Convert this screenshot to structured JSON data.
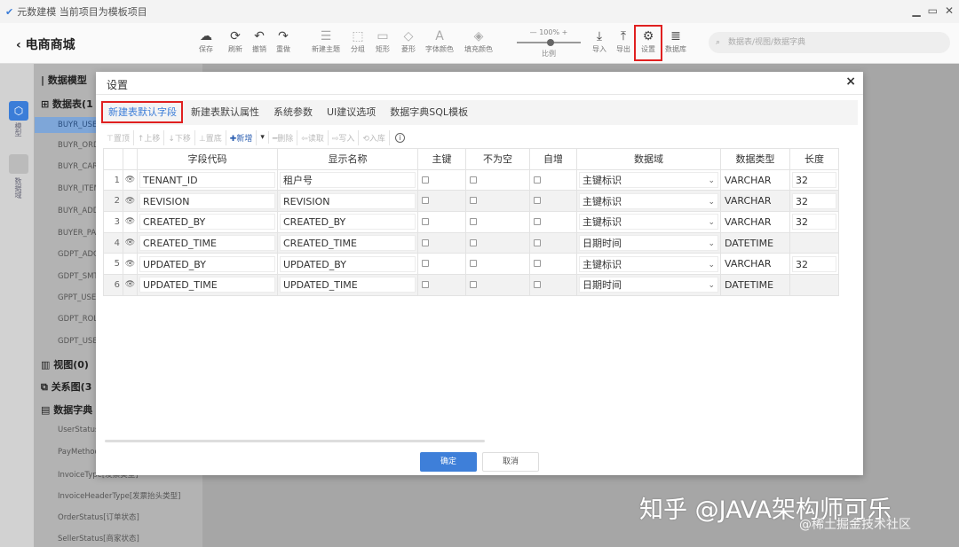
{
  "app": {
    "title": "元数建模  当前项目为模板项目",
    "window_controls": [
      "▁",
      "▭",
      "✕"
    ]
  },
  "header": {
    "back_label": "电商商城",
    "tools": [
      {
        "icon": "cloud-save-icon",
        "glyph": "☁",
        "label": "保存"
      },
      {
        "icon": "refresh-icon",
        "glyph": "⟳",
        "label": "刷新"
      },
      {
        "icon": "undo-icon",
        "glyph": "↶",
        "label": "撤销"
      },
      {
        "icon": "redo-icon",
        "glyph": "↷",
        "label": "重做"
      },
      {
        "icon": "new-subject-icon",
        "glyph": "☰",
        "label": "新建主题"
      },
      {
        "icon": "group-icon",
        "glyph": "⬚",
        "label": "分组"
      },
      {
        "icon": "rectangle-icon",
        "glyph": "▭",
        "label": "矩形"
      },
      {
        "icon": "diamond-icon",
        "glyph": "◇",
        "label": "菱形"
      },
      {
        "icon": "font-color-icon",
        "glyph": "A",
        "label": "字体颜色"
      },
      {
        "icon": "fill-color-icon",
        "glyph": "◈",
        "label": "填充颜色"
      },
      {
        "icon": "import-icon",
        "glyph": "⤓",
        "label": "导入"
      },
      {
        "icon": "export-icon",
        "glyph": "⤒",
        "label": "导出"
      },
      {
        "icon": "settings-icon",
        "glyph": "⚙",
        "label": "设置"
      },
      {
        "icon": "database-icon",
        "glyph": "≣",
        "label": "数据库"
      }
    ],
    "zoom": {
      "value": "— 100% +",
      "label": "比例",
      "level": 1.0
    },
    "search_placeholder": "数据表/视图/数据字典"
  },
  "rail": {
    "model_label": "模型",
    "dict_label": "数据域"
  },
  "tree": {
    "section_title": "数据模型",
    "tables_header": "数据表(1",
    "tables": [
      "BUYR_USE",
      "BUYR_ORD",
      "BUYR_CAR",
      "BUYR_ITEM",
      "BUYR_ADD",
      "BUYER_PA",
      "GDPT_ADC",
      "GDPT_SMT",
      "GPPT_USE",
      "GDPT_ROL",
      "GDPT_USE"
    ],
    "views_header": "视图(0)",
    "relations_header": "关系图(3",
    "dict_header": "数据字典",
    "dicts": [
      "UserStatus",
      "PayMethod",
      "InvoiceType[发票类型]",
      "InvoiceHeaderType[发票抬头类型]",
      "OrderStatus[订单状态]",
      "SellerStatus[商家状态]"
    ]
  },
  "dialog": {
    "title": "设置",
    "close": "×",
    "tabs": [
      "新建表默认字段",
      "新建表默认属性",
      "系统参数",
      "UI建议选项",
      "数据字典SQL模板"
    ],
    "active_tab": 0,
    "toolbar": [
      {
        "label": "⊤置顶",
        "enabled": false
      },
      {
        "label": "↑上移",
        "enabled": false
      },
      {
        "label": "↓下移",
        "enabled": false
      },
      {
        "label": "⊥置底",
        "enabled": false
      },
      {
        "label": "✚新增",
        "enabled": true,
        "blue": true
      },
      {
        "label": "▾",
        "enabled": true
      },
      {
        "label": "━删除",
        "enabled": false
      },
      {
        "label": "⇦读取",
        "enabled": false
      },
      {
        "label": "⇨写入",
        "enabled": false
      },
      {
        "label": "⟲入库",
        "enabled": false
      }
    ],
    "info_icon": "i",
    "columns": [
      "",
      "",
      "字段代码",
      "显示名称",
      "主键",
      "不为空",
      "自增",
      "数据域",
      "数据类型",
      "长度"
    ],
    "rows": [
      {
        "n": "1",
        "code": "TENANT_ID",
        "name": "租户号",
        "domain": "主键标识",
        "type": "VARCHAR",
        "len": "32"
      },
      {
        "n": "2",
        "code": "REVISION",
        "name": "REVISION",
        "domain": "主键标识",
        "type": "VARCHAR",
        "len": "32"
      },
      {
        "n": "3",
        "code": "CREATED_BY",
        "name": "CREATED_BY",
        "domain": "主键标识",
        "type": "VARCHAR",
        "len": "32"
      },
      {
        "n": "4",
        "code": "CREATED_TIME",
        "name": "CREATED_TIME",
        "domain": "日期时间",
        "type": "DATETIME",
        "len": ""
      },
      {
        "n": "5",
        "code": "UPDATED_BY",
        "name": "UPDATED_BY",
        "domain": "主键标识",
        "type": "VARCHAR",
        "len": "32"
      },
      {
        "n": "6",
        "code": "UPDATED_TIME",
        "name": "UPDATED_TIME",
        "domain": "日期时间",
        "type": "DATETIME",
        "len": ""
      }
    ],
    "ok_label": "确定",
    "cancel_label": "取消"
  },
  "watermark": {
    "main": "知乎 @JAVA架构师可乐",
    "sub": "@稀土掘金技术社区"
  },
  "colors": {
    "accent": "#3b7dd8",
    "highlight": "#e02020"
  }
}
